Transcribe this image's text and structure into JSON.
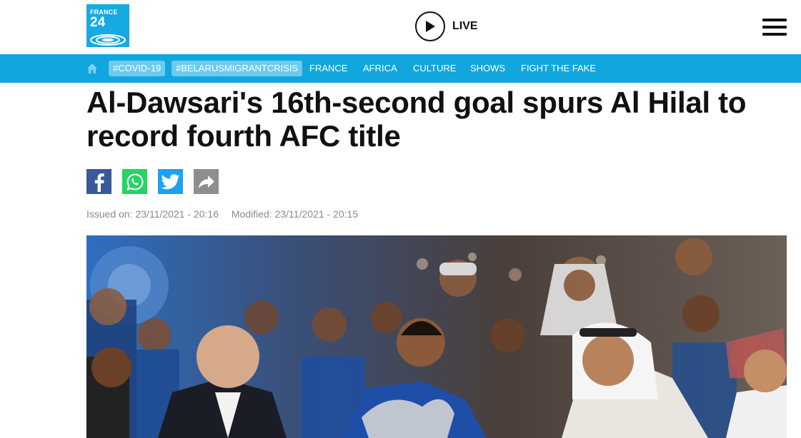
{
  "brand": {
    "logo_line1": "FRANCE",
    "logo_line2": "24",
    "color": "#17a9e1"
  },
  "header": {
    "live_label": "LIVE"
  },
  "nav": {
    "background": "#11a6de",
    "tags": [
      "#COVID-19",
      "#BELARUSMIGRANTCRISIS"
    ],
    "links": [
      "FRANCE",
      "AFRICA",
      "CULTURE",
      "SHOWS",
      "FIGHT THE FAKE"
    ]
  },
  "article": {
    "headline": "Al-Dawsari's 16th-second goal spurs Al Hilal to record fourth AFC title",
    "issued": "Issued on: 23/11/2021 - 20:16",
    "modified": "Modified: 23/11/2021 - 20:15"
  },
  "share_icons": [
    "facebook-icon",
    "whatsapp-icon",
    "twitter-icon",
    "share-icon"
  ],
  "colors": {
    "facebook": "#3b5998",
    "whatsapp": "#25d366",
    "twitter": "#1da1f2",
    "share": "#8e8e8e"
  }
}
